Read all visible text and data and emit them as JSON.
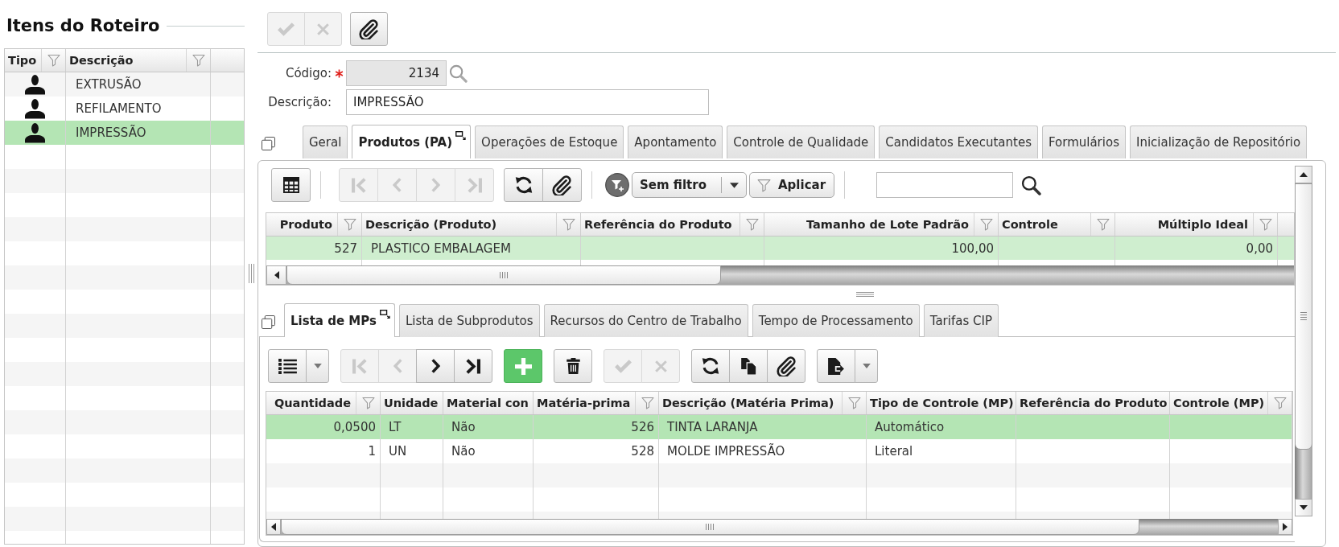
{
  "left_panel": {
    "title": "Itens do Roteiro",
    "grid": {
      "focused": true,
      "columns": [
        {
          "label": "Tipo",
          "numeric": false,
          "filter": true
        },
        {
          "label": "Descrição",
          "numeric": false,
          "filter": true
        }
      ],
      "rows": [
        {
          "selected": false,
          "cells": [
            {
              "kind": "person"
            },
            "EXTRUSÃO"
          ]
        },
        {
          "selected": false,
          "cells": [
            {
              "kind": "person"
            },
            "REFILAMENTO"
          ]
        },
        {
          "selected": true,
          "cells": [
            {
              "kind": "person"
            },
            "IMPRESSÃO"
          ]
        }
      ]
    }
  },
  "record_toolbar": [
    {
      "kind": "group",
      "buttons": [
        {
          "kind": "save",
          "disabled": true
        },
        {
          "kind": "cancel",
          "disabled": true
        }
      ]
    },
    {
      "kind": "group",
      "buttons": [
        {
          "kind": "attach",
          "disabled": false
        }
      ]
    }
  ],
  "form": {
    "fields": [
      {
        "label": "Código:",
        "numeric": true,
        "required": true,
        "readonly": true,
        "lookup": true,
        "value": "2134"
      },
      {
        "label": "Descrição:",
        "numeric": false,
        "required": false,
        "readonly": false,
        "lookup": false,
        "value": "IMPRESSÃO"
      }
    ]
  },
  "main_tabs": [
    {
      "label": "Geral",
      "selected": false
    },
    {
      "label": "Produtos (PA)",
      "selected": true
    },
    {
      "label": "Operações de Estoque",
      "selected": false
    },
    {
      "label": "Apontamento",
      "selected": false
    },
    {
      "label": "Controle de Qualidade",
      "selected": false
    },
    {
      "label": "Candidatos Executantes",
      "selected": false
    },
    {
      "label": "Formulários",
      "selected": false
    },
    {
      "label": "Inicialização de Repositório",
      "selected": false
    }
  ],
  "products": {
    "toolbar": [
      {
        "kind": "group",
        "buttons": [
          {
            "kind": "grid",
            "disabled": false
          }
        ]
      },
      {
        "kind": "separator"
      },
      {
        "kind": "group",
        "buttons": [
          {
            "kind": "first",
            "disabled": true
          },
          {
            "kind": "previous",
            "disabled": true
          },
          {
            "kind": "next",
            "disabled": true
          },
          {
            "kind": "last",
            "disabled": true
          }
        ]
      },
      {
        "kind": "group",
        "buttons": [
          {
            "kind": "refresh",
            "disabled": false
          },
          {
            "kind": "attach",
            "disabled": false
          }
        ]
      },
      {
        "kind": "separator"
      },
      {
        "kind": "filter",
        "value": "Sem filtro",
        "apply_label": "Aplicar"
      },
      {
        "kind": "separator"
      },
      {
        "kind": "search"
      }
    ],
    "grid": {
      "focused": false,
      "columns": [
        {
          "label": "Produto",
          "numeric": true,
          "filter": true
        },
        {
          "label": "Descrição (Produto)",
          "numeric": false,
          "filter": true
        },
        {
          "label": "Referência do Produto",
          "numeric": false,
          "filter": true
        },
        {
          "label": "Tamanho de Lote Padrão",
          "numeric": true,
          "filter": true
        },
        {
          "label": "Controle",
          "numeric": false,
          "filter": true
        },
        {
          "label": "Múltiplo Ideal",
          "numeric": true,
          "filter": true
        }
      ],
      "rows": [
        {
          "selected": true,
          "cells": [
            "527",
            "PLASTICO EMBALAGEM",
            null,
            "100,00",
            null,
            "0,00"
          ]
        }
      ]
    }
  },
  "sub_tabs": [
    {
      "label": "Lista de MPs",
      "selected": true
    },
    {
      "label": "Lista de Subprodutos",
      "selected": false
    },
    {
      "label": "Recursos do Centro de Trabalho",
      "selected": false
    },
    {
      "label": "Tempo de Processamento",
      "selected": false
    },
    {
      "label": "Tarifas CIP",
      "selected": false
    }
  ],
  "materials": {
    "toolbar": [
      {
        "kind": "group",
        "buttons": [
          {
            "kind": "list",
            "disabled": false
          },
          {
            "kind": "menu",
            "disabled": false
          }
        ]
      },
      {
        "kind": "group",
        "buttons": [
          {
            "kind": "first",
            "disabled": true
          },
          {
            "kind": "previous",
            "disabled": true
          },
          {
            "kind": "next",
            "disabled": false
          },
          {
            "kind": "last",
            "disabled": false
          }
        ]
      },
      {
        "kind": "group",
        "buttons": [
          {
            "kind": "add",
            "disabled": false
          }
        ]
      },
      {
        "kind": "group",
        "buttons": [
          {
            "kind": "delete",
            "disabled": false
          }
        ]
      },
      {
        "kind": "group",
        "buttons": [
          {
            "kind": "save",
            "disabled": true
          },
          {
            "kind": "cancel",
            "disabled": true
          }
        ]
      },
      {
        "kind": "group",
        "buttons": [
          {
            "kind": "refresh",
            "disabled": false
          },
          {
            "kind": "copy",
            "disabled": false
          },
          {
            "kind": "attach",
            "disabled": false
          }
        ]
      },
      {
        "kind": "group",
        "buttons": [
          {
            "kind": "export",
            "disabled": false
          },
          {
            "kind": "menu",
            "disabled": false
          }
        ]
      }
    ],
    "grid": {
      "focused": true,
      "columns": [
        {
          "label": "Quantidade",
          "numeric": true,
          "filter": true
        },
        {
          "label": "Unidade",
          "numeric": false,
          "filter": false
        },
        {
          "label": "Material con",
          "numeric": false,
          "filter": false
        },
        {
          "label": "Matéria-prima",
          "numeric": true,
          "filter": true
        },
        {
          "label": "Descrição (Matéria Prima)",
          "numeric": false,
          "filter": true
        },
        {
          "label": "Tipo de Controle (MP)",
          "numeric": false,
          "filter": false
        },
        {
          "label": "Referência do Produto",
          "filter": false
        },
        {
          "label": "Controle (MP)",
          "filter": true
        }
      ],
      "rows": [
        {
          "selected": true,
          "cells": [
            "0,0500",
            "LT",
            "Não",
            "526",
            "TINTA LARANJA",
            "Automático",
            null,
            null
          ]
        },
        {
          "selected": false,
          "cells": [
            "1",
            "UN",
            "Não",
            "528",
            "MOLDE IMPRESSÃO",
            "Literal",
            null,
            null
          ]
        }
      ]
    }
  }
}
